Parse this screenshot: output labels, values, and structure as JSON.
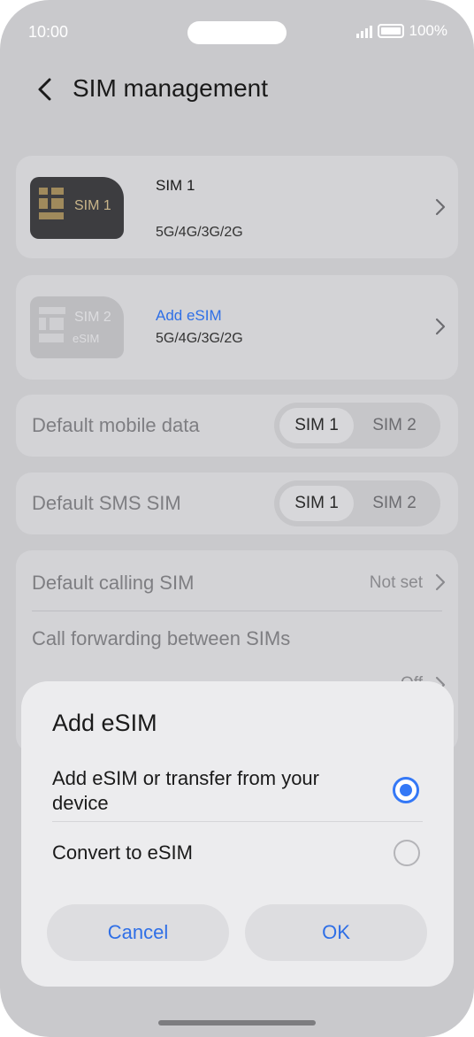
{
  "status_bar": {
    "time": "10:00",
    "battery": "100%"
  },
  "header": {
    "title": "SIM management"
  },
  "sim1": {
    "card_label": "SIM 1",
    "name": "SIM 1",
    "sub": "5G/4G/3G/2G"
  },
  "sim2": {
    "card_label": "SIM 2",
    "card_sublabel": "eSIM",
    "name": "Add eSIM",
    "sub": "5G/4G/3G/2G"
  },
  "default_data": {
    "label": "Default mobile data",
    "options": [
      "SIM 1",
      "SIM 2"
    ]
  },
  "default_sms": {
    "label": "Default SMS SIM",
    "options": [
      "SIM 1",
      "SIM 2"
    ]
  },
  "default_calling": {
    "label": "Default calling SIM",
    "value": "Not set"
  },
  "call_forwarding": {
    "label": "Call forwarding between SIMs",
    "value": "Off"
  },
  "dialog": {
    "title": "Add eSIM",
    "options": [
      {
        "label": "Add eSIM or transfer from your device",
        "selected": true
      },
      {
        "label": "Convert to eSIM",
        "selected": false
      }
    ],
    "cancel_label": "Cancel",
    "ok_label": "OK"
  },
  "colors": {
    "accent": "#3478f6",
    "link": "#2f6fe6",
    "scrim": "#c9c9cc"
  }
}
